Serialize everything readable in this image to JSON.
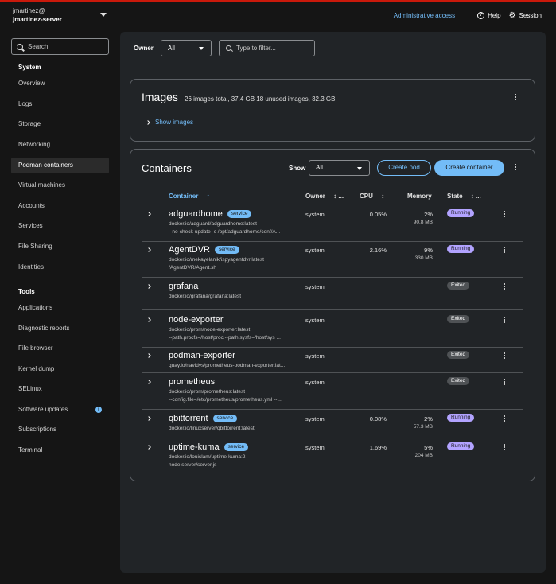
{
  "host": {
    "user": "jmartinez@",
    "server": "jmartinez-server"
  },
  "topbar": {
    "admin_access": "Administrative access",
    "help": "Help",
    "session": "Session"
  },
  "sidebar": {
    "search_placeholder": "Search",
    "system_section": "System",
    "system_items": [
      "Overview",
      "Logs",
      "Storage",
      "Networking",
      "Podman containers",
      "Virtual machines",
      "Accounts",
      "Services",
      "File Sharing",
      "Identities"
    ],
    "active_item": "Podman containers",
    "tools_section": "Tools",
    "tools_items": [
      "Applications",
      "Diagnostic reports",
      "File browser",
      "Kernel dump",
      "SELinux",
      "Software updates",
      "Subscriptions",
      "Terminal"
    ]
  },
  "filters": {
    "owner_label": "Owner",
    "owner_value": "All",
    "filter_placeholder": "Type to filter..."
  },
  "images": {
    "title": "Images",
    "summary": "26 images total, 37.4 GB 18 unused images, 32.3 GB",
    "show_label": "Show images"
  },
  "containers": {
    "title": "Containers",
    "show_label": "Show",
    "show_value": "All",
    "create_pod": "Create pod",
    "create_container": "Create container",
    "columns": {
      "container": "Container",
      "owner": "Owner",
      "cpu": "CPU",
      "memory": "Memory",
      "state": "State"
    },
    "sort_icon": "↑",
    "sortable_icon": "↕",
    "ellipsis": "...",
    "rows": [
      {
        "name": "adguardhome",
        "service": "service",
        "image": "docker.io/adguard/adguardhome:latest",
        "command": "--no-check-update -c /opt/adguardhome/conf/A...",
        "owner": "system",
        "cpu": "0.05%",
        "mem_pct": "2%",
        "mem": "90.8 MB",
        "state": "Running"
      },
      {
        "name": "AgentDVR",
        "service": "service",
        "image": "docker.io/mekayelanik/ispyagentdvr:latest",
        "command": "/AgentDVR/Agent.sh",
        "owner": "system",
        "cpu": "2.16%",
        "mem_pct": "9%",
        "mem": "330 MB",
        "state": "Running"
      },
      {
        "name": "grafana",
        "service": "",
        "image": "docker.io/grafana/grafana:latest",
        "command": "",
        "owner": "system",
        "cpu": "",
        "mem_pct": "",
        "mem": "",
        "state": "Exited"
      },
      {
        "name": "node-exporter",
        "service": "",
        "image": "docker.io/prom/node-exporter:latest",
        "command": "--path.procfs=/host/proc --path.sysfs=/host/sys ...",
        "owner": "system",
        "cpu": "",
        "mem_pct": "",
        "mem": "",
        "state": "Exited"
      },
      {
        "name": "podman-exporter",
        "service": "",
        "image": "quay.io/navidys/prometheus-podman-exporter:lat...",
        "command": "",
        "owner": "system",
        "cpu": "",
        "mem_pct": "",
        "mem": "",
        "state": "Exited"
      },
      {
        "name": "prometheus",
        "service": "",
        "image": "docker.io/prom/prometheus:latest",
        "command": "--config.file=/etc/prometheus/prometheus.yml --...",
        "owner": "system",
        "cpu": "",
        "mem_pct": "",
        "mem": "",
        "state": "Exited"
      },
      {
        "name": "qbittorrent",
        "service": "service",
        "image": "docker.io/linuxserver/qbittorrent:latest",
        "command": "",
        "owner": "system",
        "cpu": "0.08%",
        "mem_pct": "2%",
        "mem": "57.3 MB",
        "state": "Running"
      },
      {
        "name": "uptime-kuma",
        "service": "service",
        "image": "docker.io/louislam/uptime-kuma:2",
        "command": "node server/server.js",
        "owner": "system",
        "cpu": "1.69%",
        "mem_pct": "5%",
        "mem": "204 MB",
        "state": "Running"
      }
    ]
  }
}
